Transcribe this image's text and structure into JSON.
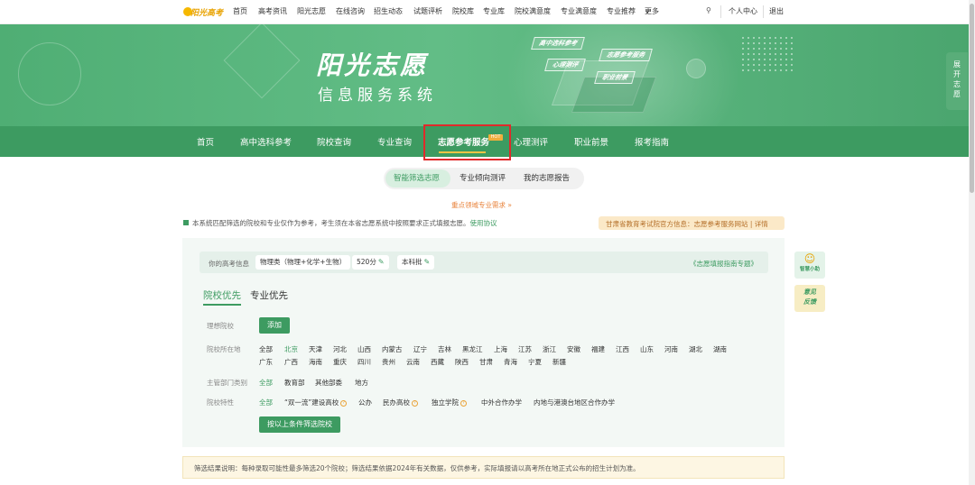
{
  "logo": {
    "text": "阳光高考"
  },
  "topnav": {
    "items": [
      "首页",
      "高考资讯",
      "阳光志愿",
      "在线咨询",
      "招生动态",
      "试题评析",
      "院校库",
      "专业库",
      "院校满意度",
      "专业满意度",
      "专业推荐",
      "更多"
    ],
    "user_center": "个人中心",
    "logout": "退出"
  },
  "hero": {
    "title": "阳光志愿",
    "subtitle": "信息服务系统",
    "tags": [
      "高中选科参考",
      "心理测评",
      "志愿参考服务",
      "职业前景"
    ]
  },
  "side_tab": "展开志愿",
  "mainnav": {
    "items": [
      "首页",
      "高中选科参考",
      "院校查询",
      "专业查询",
      "志愿参考服务",
      "心理测评",
      "职业前景",
      "报考指南"
    ],
    "hot_badge": "HOT",
    "active_index": 4
  },
  "subtabs": {
    "items": [
      "智能筛选志愿",
      "专业倾向测评",
      "我的志愿报告"
    ],
    "active_index": 0
  },
  "hint_link": "重点领域专业需求 »",
  "notice": {
    "text": "本系统匹配筛选的院校和专业仅作为参考，考生须在本省志愿系统中按照要求正式填报志愿。",
    "link": "使用协议"
  },
  "official": "甘肃省教育考试院官方信息：志愿参考服务网站 | 详情",
  "exam_info": {
    "label": "你的高考信息",
    "subject": "物理类（物理+化学+生物）",
    "score": "520分",
    "batch": "本科批",
    "guide": "《志愿填报指南专题》"
  },
  "modes": {
    "school_first": "院校优先",
    "major_first": "专业优先"
  },
  "filters": {
    "ideal_label": "理想院校",
    "add_label": "添加",
    "location_label": "院校所在地",
    "locations_row1": [
      "全部",
      "北京",
      "天津",
      "河北",
      "山西",
      "内蒙古",
      "辽宁",
      "吉林",
      "黑龙江",
      "上海",
      "江苏",
      "浙江",
      "安徽",
      "福建",
      "江西",
      "山东",
      "河南",
      "湖北",
      "湖南"
    ],
    "locations_row2": [
      "广东",
      "广西",
      "海南",
      "重庆",
      "四川",
      "贵州",
      "云南",
      "西藏",
      "陕西",
      "甘肃",
      "青海",
      "宁夏",
      "新疆"
    ],
    "location_selected": "北京",
    "dept_label": "主管部门类别",
    "depts": [
      "全部",
      "教育部",
      "其他部委",
      "地方"
    ],
    "trait_label": "院校特性",
    "traits": [
      "全部",
      "“双一流”建设高校",
      "公办",
      "民办高校",
      "独立学院",
      "中外合作办学",
      "内地与港澳台地区合作办学"
    ],
    "filter_button": "按以上条件筛选院校"
  },
  "result_note": "筛选结果说明：每种录取可能性最多筛选20个院校；筛选结果依据2024年有关数据，仅供参考，实际填报请以高考所在地正式公布的招生计划为准。",
  "floats": {
    "assistant": "智慧小助",
    "feedback": "意见反馈"
  },
  "colors": {
    "primary": "#3d9b61",
    "hero": "#5db37f",
    "accent": "#e8823a",
    "highlight_box": "#e02a2a"
  }
}
